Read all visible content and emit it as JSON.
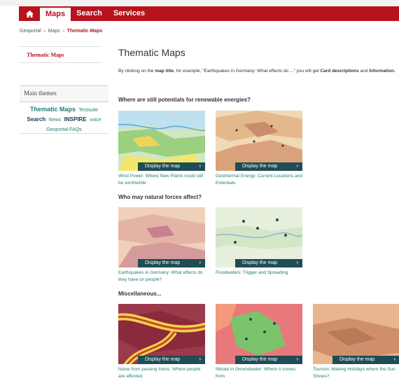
{
  "nav": {
    "home_icon": "home-icon",
    "items": [
      "Maps",
      "Search",
      "Services"
    ]
  },
  "breadcrumb": {
    "items": [
      "Geoportal",
      "Maps",
      "Thematic Maps"
    ]
  },
  "sidebar": {
    "top_item": "Thematic Maps",
    "main_themes_title": "Main themes",
    "tags": [
      "Thematic Maps",
      "Testsuite",
      "Search",
      "News",
      "INSPIRE",
      "voice",
      "Geoportal-FAQs"
    ]
  },
  "page": {
    "title": "Thematic Maps",
    "intro_a": "By clicking on the ",
    "intro_b": "map title",
    "intro_c": ", for example, \"Earthquakes in Germany: What effects do ...\" you will get ",
    "intro_d": "Card descriptions",
    "intro_e": " and ",
    "intro_f": "Information."
  },
  "display_label": "Display the map",
  "sections": [
    {
      "title": "Where are still potentials for renewable energies?",
      "cards": [
        {
          "caption": "Wind Power: Where New Plants could still be worthwhile"
        },
        {
          "caption": "Geothermal Energy: Current Locations and Potentials"
        }
      ]
    },
    {
      "title": "Who may natural forces affect?",
      "cards": [
        {
          "caption": "Earthquakes in Germany: What effects do they have on people?"
        },
        {
          "caption": "Floodwaters: Trigger and Spreading"
        }
      ]
    },
    {
      "title": "Miscellaneous...",
      "cards": [
        {
          "caption": "Noise from passing trains: Where people are affected"
        },
        {
          "caption": "Nitrate in Groundwater: Where it comes from"
        },
        {
          "caption": "Tourism: Making Holidays where the Sun Shines?"
        }
      ]
    }
  ],
  "colors": {
    "brand_red": "#b8121d",
    "teal_bar": "#1f4c55",
    "link_teal": "#1f7f74"
  }
}
